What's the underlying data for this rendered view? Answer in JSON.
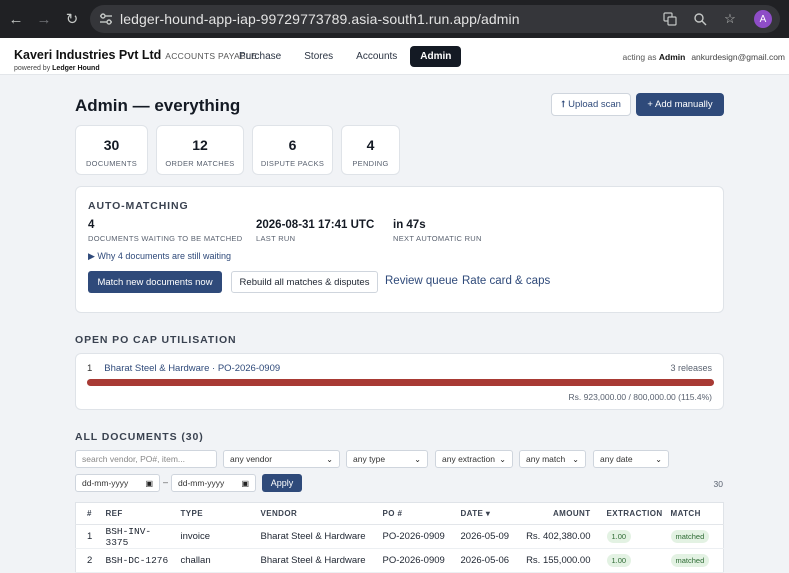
{
  "browser": {
    "url": "ledger-hound-app-iap-99729773789.asia-south1.run.app/admin",
    "avatar_letter": "A"
  },
  "header": {
    "company": "Kaveri Industries Pvt Ltd",
    "module": "ACCOUNTS PAYABLE",
    "powered_by_prefix": "powered by",
    "powered_by_name": "Ledger Hound",
    "nav": [
      "Purchase",
      "Stores",
      "Accounts",
      "Admin"
    ],
    "active_nav": "Admin",
    "acting_prefix": "acting as",
    "acting_role": "Admin",
    "email": "ankurdesign@gmail.com"
  },
  "page": {
    "title": "Admin — everything",
    "upload_label": "⭡ Upload scan",
    "add_label": "+ Add manually"
  },
  "stats": [
    {
      "value": "30",
      "label": "DOCUMENTS"
    },
    {
      "value": "12",
      "label": "ORDER MATCHES"
    },
    {
      "value": "6",
      "label": "DISPUTE PACKS"
    },
    {
      "value": "4",
      "label": "PENDING"
    }
  ],
  "auto_matching": {
    "heading": "AUTO-MATCHING",
    "waiting_value": "4",
    "waiting_label": "DOCUMENTS WAITING TO BE MATCHED",
    "last_run_value": "2026-08-31 17:41 UTC",
    "last_run_label": "LAST RUN",
    "next_value": "in 47s",
    "next_label": "NEXT AUTOMATIC RUN",
    "why_text": "▶ Why 4 documents are still waiting",
    "match_button": "Match new documents now",
    "rebuild_button": "Rebuild all matches & disputes",
    "review_link": "Review queue",
    "rate_link": "Rate card & caps"
  },
  "po_cap": {
    "heading": "OPEN PO CAP UTILISATION",
    "index": "1",
    "vendor_po": "Bharat Steel & Hardware · PO-2026-0909",
    "releases": "3 releases",
    "amount_text": "Rs. 923,000.00 / 800,000.00 (115.4%)",
    "utilisation_percent": 115.4,
    "bar_color": "#a83a34"
  },
  "documents": {
    "heading": "ALL DOCUMENTS (30)",
    "search_placeholder": "search vendor, PO#, item...",
    "filters": {
      "vendor": "any vendor",
      "type": "any type",
      "extraction": "any extraction",
      "match": "any match",
      "date": "any date"
    },
    "date_from": "dd-mm-yyyy",
    "date_to": "dd-mm-yyyy",
    "range_sep": "–",
    "apply_label": "Apply",
    "count": "30",
    "columns": [
      "#",
      "REF",
      "TYPE",
      "VENDOR",
      "PO #",
      "DATE ▾",
      "AMOUNT",
      "EXTRACTION",
      "MATCH"
    ],
    "rows": [
      {
        "n": "1",
        "ref": "BSH-INV-3375",
        "type": "invoice",
        "vendor": "Bharat Steel & Hardware",
        "po": "PO-2026-0909",
        "date": "2026-05-09",
        "amount": "Rs. 402,380.00",
        "extraction": "1.00",
        "match": "matched"
      },
      {
        "n": "2",
        "ref": "BSH-DC-1276",
        "type": "challan",
        "vendor": "Bharat Steel & Hardware",
        "po": "PO-2026-0909",
        "date": "2026-05-06",
        "amount": "Rs. 155,000.00",
        "extraction": "1.00",
        "match": "matched"
      }
    ]
  }
}
